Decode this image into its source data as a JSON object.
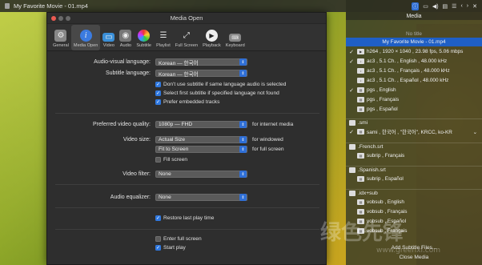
{
  "player": {
    "title": "My Favorite Movie - 01.mp4"
  },
  "dialog": {
    "title": "Media Open",
    "toolbar": [
      {
        "label": "General",
        "icon": "general-icon"
      },
      {
        "label": "Media Open",
        "icon": "info-icon"
      },
      {
        "label": "Video",
        "icon": "monitor-icon"
      },
      {
        "label": "Audio",
        "icon": "speaker-icon"
      },
      {
        "label": "Subtitle",
        "icon": "subtitle-icon"
      },
      {
        "label": "Playlist",
        "icon": "list-icon"
      },
      {
        "label": "Full Screen",
        "icon": "fullscreen-icon"
      },
      {
        "label": "Playback",
        "icon": "play-icon"
      },
      {
        "label": "Keyboard",
        "icon": "keyboard-icon"
      }
    ],
    "av_language": {
      "label": "Audio-visual language:",
      "value": "Korean — 한국어"
    },
    "sub_language": {
      "label": "Subtitle language:",
      "value": "Korean — 한국어"
    },
    "checks1": [
      {
        "label": "Don't use subtitle if same language audio is selected",
        "checked": true
      },
      {
        "label": "Select first subtitle if specified language not found",
        "checked": true
      },
      {
        "label": "Prefer embedded tracks",
        "checked": true
      }
    ],
    "video_quality": {
      "label": "Preferred video quality:",
      "value": "1080p — FHD",
      "note": "for internet media"
    },
    "video_size": {
      "label": "Video size:",
      "value1": "Actual Size",
      "note1": "for windowed",
      "value2": "Fit to Screen",
      "note2": "for full screen"
    },
    "fill_screen": {
      "label": "Fill screen",
      "checked": false
    },
    "video_filter": {
      "label": "Video filter:",
      "value": "None"
    },
    "audio_eq": {
      "label": "Audio equalizer:",
      "value": "None"
    },
    "restore": {
      "label": "Restore last play time",
      "checked": true
    },
    "enter_fs": {
      "label": "Enter full screen",
      "checked": false
    },
    "start_play": {
      "label": "Start play",
      "checked": true
    }
  },
  "sidebar": {
    "media_title": "Media",
    "file": "My Favorite Movie - 01.mp4",
    "no_title": "No title",
    "tracks": [
      {
        "type": "V",
        "text": "h264 ,  1920 × 1040 , 23.98 fps, 5.06 mbps",
        "checked": true
      },
      {
        "type": "A",
        "text": "ac3 ,  5.1 Ch. ,  English , 48.000 kHz",
        "checked": true
      },
      {
        "type": "A",
        "text": "ac3 ,  5.1 Ch. ,  Français , 48.000 kHz",
        "checked": false
      },
      {
        "type": "A",
        "text": "ac3 ,  5.1 Ch. ,  Español , 48.000 kHz",
        "checked": false
      },
      {
        "type": "S",
        "text": "pgs ,  English",
        "checked": true
      },
      {
        "type": "S",
        "text": "pgs ,  Français",
        "checked": false
      },
      {
        "type": "S",
        "text": "pgs ,  Español",
        "checked": false
      }
    ],
    "smi_head": ".smi",
    "smi_item": "sami ,  한국어 , \"한국어\", KRCC, ko-KR",
    "french_head": ".French.srt",
    "french_item": "subrip ,  Français",
    "spanish_head": ".Spanish.srt",
    "spanish_item": "subrip ,  Español",
    "idx_head": ".idx+sub",
    "idx_items": [
      "vobsub ,  English",
      "vobsub ,  Français",
      "vobsub ,  Español",
      "vobsub ,  Français"
    ],
    "add_subtitle": "Add Subtitle Files...",
    "close_media": "Close Media"
  },
  "watermark": {
    "text": "绿色先锋",
    "url": "www.greenxf.com"
  }
}
